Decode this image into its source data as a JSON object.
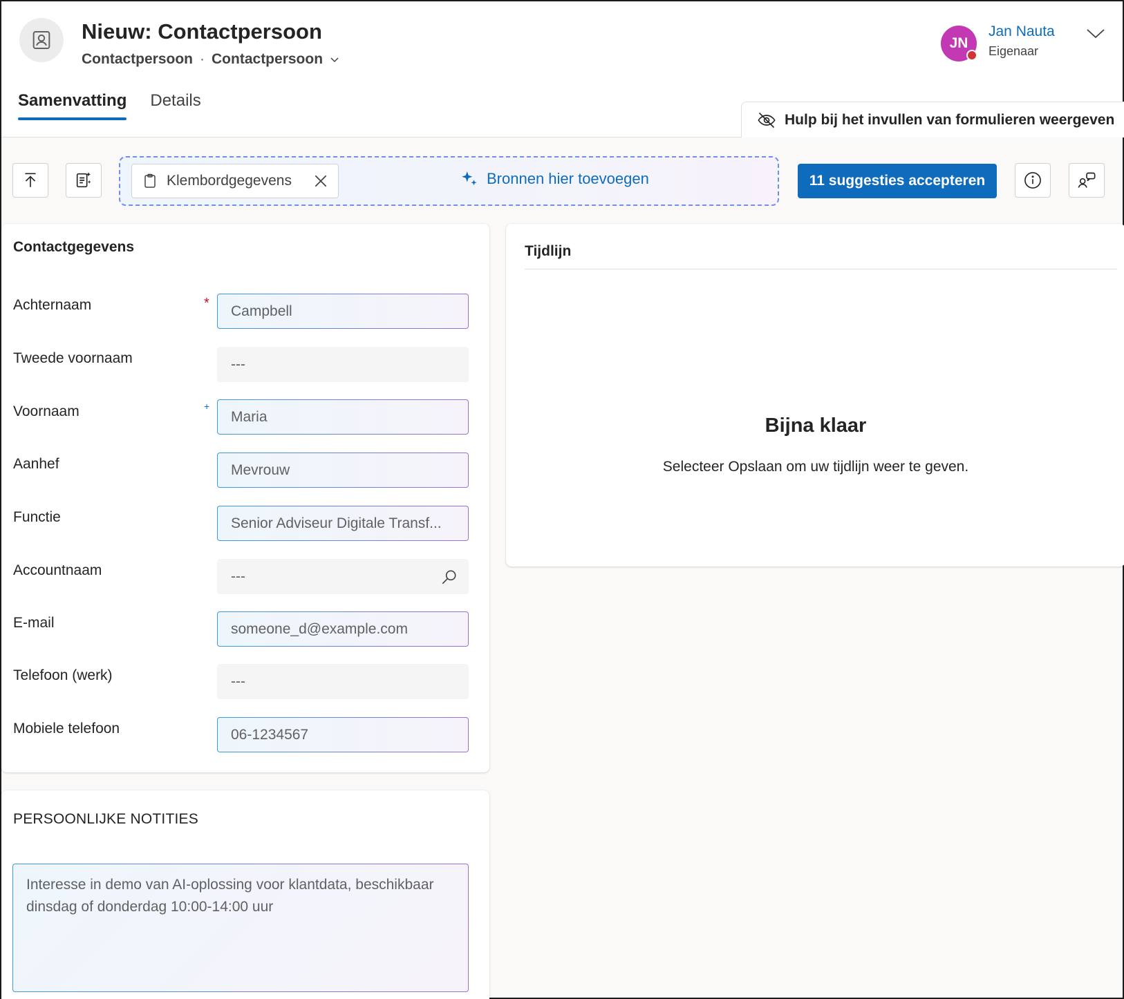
{
  "header": {
    "title": "Nieuw: Contactpersoon",
    "subtitle_entity": "Contactpersoon",
    "subtitle_separator": "·",
    "subtitle_form": "Contactpersoon",
    "entity_icon": "contact-card-icon",
    "owner": {
      "initials": "JN",
      "name": "Jan Nauta",
      "role": "Eigenaar",
      "avatar_color": "#c239b3",
      "presence_color": "#d13438"
    }
  },
  "tabs": [
    {
      "label": "Samenvatting",
      "active": true
    },
    {
      "label": "Details",
      "active": false
    }
  ],
  "form_assist": {
    "label": "Hulp bij het invullen van formulieren weergeven",
    "icon": "eye-off-icon"
  },
  "toolbar": {
    "scroll_top_icon": "arrow-up-to-line-icon",
    "ai_notes_icon": "sparkle-notes-icon",
    "source_chip": {
      "label": "Klembordgegevens",
      "icon": "clipboard-icon"
    },
    "add_sources_label": "Bronnen hier toevoegen",
    "accept_label": "11 suggesties accepteren",
    "accent": "#0f6cbd",
    "info_icon": "info-icon",
    "feedback_icon": "people-chat-icon"
  },
  "contact": {
    "section_title": "Contactgegevens",
    "required_marker": "*",
    "recommended_marker": "+",
    "fields": [
      {
        "label": "Achternaam",
        "value": "Campbell",
        "required": true
      },
      {
        "label": "Tweede voornaam",
        "value": "---"
      },
      {
        "label": "Voornaam",
        "value": "Maria",
        "recommended": true
      },
      {
        "label": "Aanhef",
        "value": "Mevrouw"
      },
      {
        "label": "Functie",
        "value": "Senior Adviseur Digitale Transf..."
      },
      {
        "label": "Accountnaam",
        "value": "---",
        "lookup_icon": "search-icon"
      },
      {
        "label": "E-mail",
        "value": "someone_d@example.com"
      },
      {
        "label": "Telefoon (werk)",
        "value": "---"
      },
      {
        "label": "Mobiele telefoon",
        "value": "06-1234567"
      }
    ]
  },
  "timeline": {
    "title": "Tijdlijn",
    "empty_title": "Bijna klaar",
    "empty_text": "Selecteer Opslaan om uw tijdlijn weer te geven."
  },
  "notes": {
    "title": "PERSOONLIJKE NOTITIES",
    "text": "Interesse in demo van AI-oplossing voor klantdata, beschikbaar dinsdag of donderdag 10:00-14:00 uur"
  }
}
